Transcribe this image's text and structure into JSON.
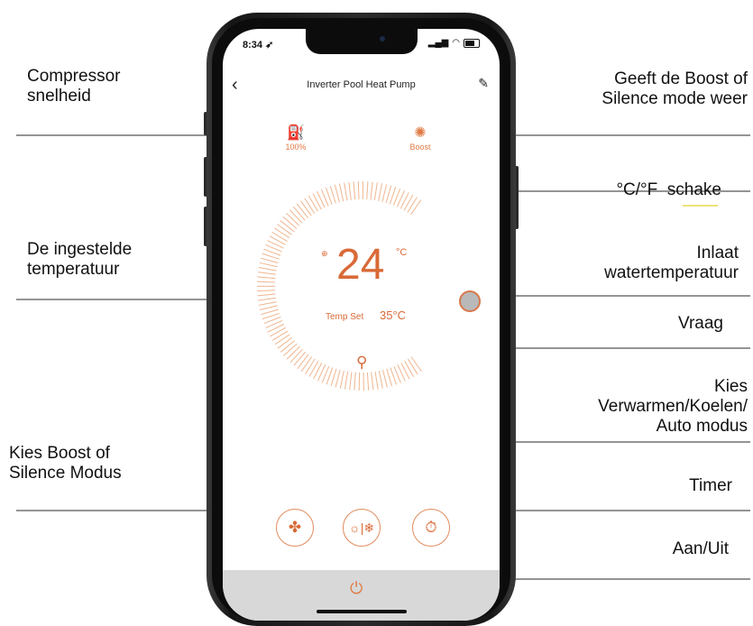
{
  "annotations": {
    "compressor": [
      "Compressor",
      "snelheid"
    ],
    "boost_display": [
      "Geeft de Boost of",
      "Silence mode weer"
    ],
    "unit_switch": "°C/°F  schake",
    "set_temp": [
      "De ingestelde",
      "temperatuur"
    ],
    "inlet_temp": [
      "Inlaat",
      "watertemperatuur"
    ],
    "query": "Vraag",
    "mode_select": [
      "Kies",
      "Verwarmen/Koelen/",
      "Auto modus"
    ],
    "boost_select": [
      "Kies Boost of",
      "Silence Modus"
    ],
    "timer": "Timer",
    "power": "Aan/Uit"
  },
  "phone": {
    "status_time": "8:34",
    "title": "Inverter Pool Heat Pump",
    "compressor_value": "100%",
    "fan_mode": "Boost",
    "set_temperature": "24",
    "unit": "°C",
    "temp_set_label": "Temp Set",
    "inlet_temperature": "35°C"
  },
  "icons": [
    "back-chevron-icon",
    "edit-pen-icon",
    "compressor-icon",
    "fan-icon",
    "query-search-icon",
    "fan-mode-icon",
    "heat-cool-icon",
    "timer-icon",
    "power-icon"
  ],
  "colors": {
    "accent": "#d96a37",
    "dial_tick": "#f0b58f",
    "bottom_bar": "#d8d8d8"
  }
}
